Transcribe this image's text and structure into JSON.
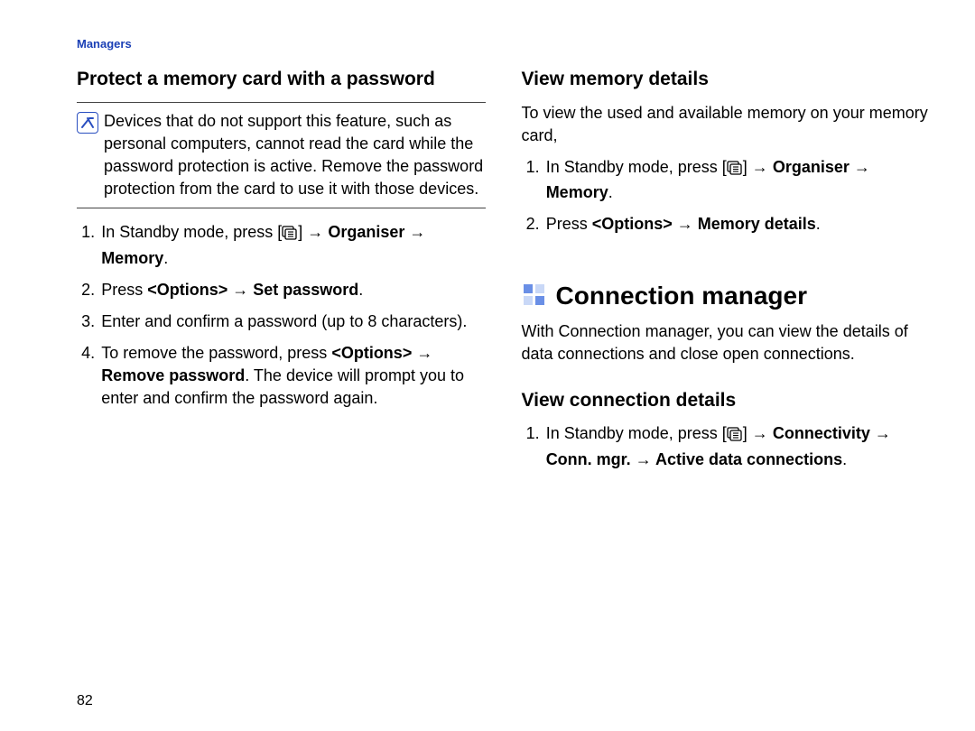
{
  "header": {
    "section_label": "Managers"
  },
  "left": {
    "heading": "Protect a memory card with a password",
    "note": "Devices that do not support this feature, such as personal computers, cannot read the card while the password protection is active. Remove the password protection from the card to use it with those devices.",
    "steps": {
      "s1_a": "In Standby mode, press [",
      "s1_b": "] →",
      "s1_c": "Organiser → Memory",
      "s2_a": "Press ",
      "s2_b": "<Options> → Set password",
      "s3": "Enter and confirm a password (up to 8 characters).",
      "s4_a": "To remove the password, press ",
      "s4_b": "<Options> → Remove password",
      "s4_c": ". The device will prompt you to enter and confirm the password again."
    }
  },
  "right": {
    "heading_a": "View memory details",
    "para": "To view the used and available memory on your memory card,",
    "steps_a": {
      "s1_a": "In Standby mode, press [",
      "s1_b": "] →",
      "s1_c": "Organiser → Memory",
      "s2_a": "Press ",
      "s2_b": "<Options> → Memory details"
    },
    "big_heading": "Connection manager",
    "big_intro": "With Connection manager, you can view the details of data connections and close open connections.",
    "heading_b": "View connection details",
    "steps_b": {
      "s1_a": "In Standby mode, press [",
      "s1_b": "] →",
      "s1_c": "Connectivity → Conn. mgr. → Active data connections"
    }
  },
  "page_number": "82"
}
